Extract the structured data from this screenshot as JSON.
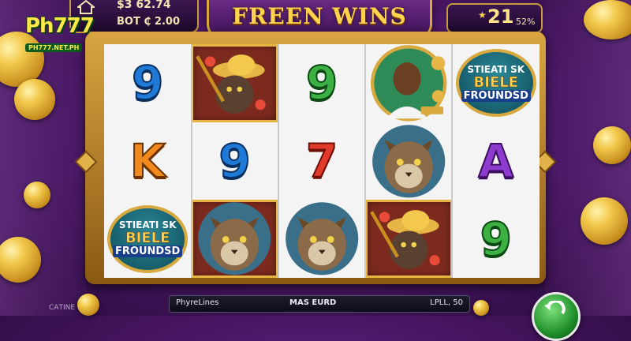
{
  "header": {
    "balance": "$3 62.74",
    "bet": "BOT ₵ 2.00",
    "title": "FREEN WINS",
    "wins_count": "21",
    "wins_percent": "52%"
  },
  "logo": {
    "main": "Ph777",
    "sub": "PH777.NET.PH"
  },
  "reels": [
    [
      {
        "type": "text",
        "value": "9",
        "color": "blue"
      },
      {
        "type": "text",
        "value": "K",
        "color": "orange"
      },
      {
        "type": "badge",
        "lines": [
          "STIEATI SK",
          "BIELE",
          "FROUNDSD"
        ]
      }
    ],
    [
      {
        "type": "pic",
        "name": "explorer-symbol",
        "highlight": true
      },
      {
        "type": "text",
        "value": "9",
        "color": "blue"
      },
      {
        "type": "pic",
        "name": "lynx-symbol",
        "highlight": true
      }
    ],
    [
      {
        "type": "text",
        "value": "9",
        "color": "green"
      },
      {
        "type": "text",
        "value": "7",
        "color": "red"
      },
      {
        "type": "pic",
        "name": "lynx-symbol",
        "highlight": false
      }
    ],
    [
      {
        "type": "pic",
        "name": "portrait-symbol",
        "highlight": false
      },
      {
        "type": "pic",
        "name": "lynx-symbol",
        "highlight": false
      },
      {
        "type": "pic",
        "name": "explorer-symbol",
        "highlight": true
      }
    ],
    [
      {
        "type": "badge",
        "lines": [
          "STIEATI SK",
          "BIELE",
          "FROUNDSD"
        ]
      },
      {
        "type": "text",
        "value": "A",
        "color": "purple"
      },
      {
        "type": "text",
        "value": "9",
        "color": "green"
      }
    ]
  ],
  "bottom_bar": {
    "left": "PhyreLines",
    "middle": "MAS EURD",
    "right": "LPLL, 50"
  },
  "corner_label": "CAТINE",
  "colors": {
    "frame_gold": "#d9a441",
    "background_purple": "#4a1766",
    "spin_green": "#1f8f2a"
  }
}
